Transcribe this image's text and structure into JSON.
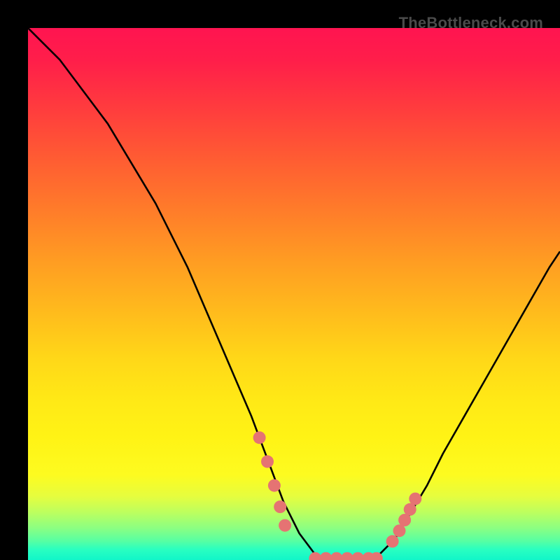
{
  "watermark": "TheBottleneck.com",
  "chart_data": {
    "type": "line",
    "title": "",
    "xlabel": "",
    "ylabel": "",
    "xlim": [
      0,
      100
    ],
    "ylim": [
      0,
      100
    ],
    "grid": false,
    "series": [
      {
        "name": "bottleneck-curve",
        "x": [
          0,
          3,
          6,
          9,
          12,
          15,
          18,
          21,
          24,
          27,
          30,
          33,
          36,
          39,
          42,
          45,
          48,
          51,
          54,
          57,
          60,
          63,
          66,
          69,
          72,
          75,
          78,
          82,
          86,
          90,
          94,
          98,
          100
        ],
        "values": [
          100,
          97,
          94,
          90,
          86,
          82,
          77,
          72,
          67,
          61,
          55,
          48,
          41,
          34,
          27,
          19,
          11,
          5,
          1,
          0,
          0,
          0,
          1,
          4,
          9,
          14,
          20,
          27,
          34,
          41,
          48,
          55,
          58
        ]
      }
    ],
    "markers": {
      "name": "scatter-dots",
      "color": "#e57373",
      "points_x": [
        43.5,
        45.0,
        46.3,
        47.4,
        48.3,
        54.0,
        56.0,
        58.0,
        60.0,
        62.0,
        64.0,
        65.5,
        68.5,
        69.8,
        70.8,
        71.8,
        72.8
      ],
      "points_y": [
        23.0,
        18.5,
        14.0,
        10.0,
        6.5,
        0.3,
        0.3,
        0.3,
        0.3,
        0.3,
        0.3,
        0.3,
        3.5,
        5.5,
        7.5,
        9.5,
        11.5
      ]
    },
    "gradient_stops": [
      {
        "pos": 0.0,
        "color": "#ff1450"
      },
      {
        "pos": 0.5,
        "color": "#ffc81a"
      },
      {
        "pos": 0.84,
        "color": "#fdfb20"
      },
      {
        "pos": 1.0,
        "color": "#11f6c9"
      }
    ]
  }
}
